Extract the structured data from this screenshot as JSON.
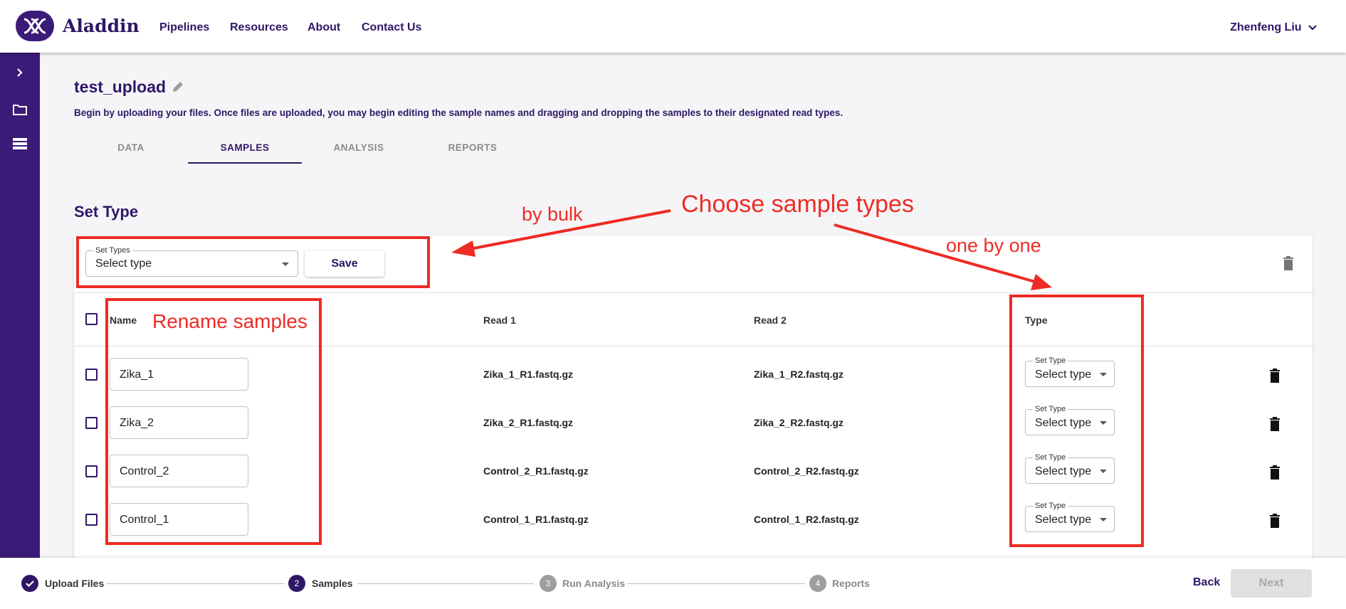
{
  "app": {
    "name": "Aladdin"
  },
  "nav": {
    "items": [
      {
        "label": "Pipelines"
      },
      {
        "label": "Resources"
      },
      {
        "label": "About"
      },
      {
        "label": "Contact Us"
      }
    ]
  },
  "user": {
    "name": "Zhenfeng Liu"
  },
  "sidebar": {
    "items": [
      {
        "icon": "chevron-right-icon"
      },
      {
        "icon": "folder-icon"
      },
      {
        "icon": "list-icon"
      }
    ]
  },
  "project": {
    "title": "test_upload",
    "description": "Begin by uploading your files. Once files are uploaded, you may begin editing the sample names and dragging and dropping the samples to their designated read types."
  },
  "tabs": [
    {
      "label": "DATA"
    },
    {
      "label": "SAMPLES",
      "active": true
    },
    {
      "label": "ANALYSIS"
    },
    {
      "label": "REPORTS"
    }
  ],
  "set_type": {
    "title": "Set Type",
    "bulk_legend": "Set Types",
    "bulk_value": "Select type",
    "save_label": "Save"
  },
  "table": {
    "headers": {
      "name": "Name",
      "read1": "Read 1",
      "read2": "Read 2",
      "type": "Type"
    },
    "rows": [
      {
        "name": "Zika_1",
        "read1": "Zika_1_R1.fastq.gz",
        "read2": "Zika_1_R2.fastq.gz",
        "type_legend": "Set Type",
        "type_value": "Select type"
      },
      {
        "name": "Zika_2",
        "read1": "Zika_2_R1.fastq.gz",
        "read2": "Zika_2_R2.fastq.gz",
        "type_legend": "Set Type",
        "type_value": "Select type"
      },
      {
        "name": "Control_2",
        "read1": "Control_2_R1.fastq.gz",
        "read2": "Control_2_R2.fastq.gz",
        "type_legend": "Set Type",
        "type_value": "Select type"
      },
      {
        "name": "Control_1",
        "read1": "Control_1_R1.fastq.gz",
        "read2": "Control_1_R2.fastq.gz",
        "type_legend": "Set Type",
        "type_value": "Select type"
      }
    ]
  },
  "annotations": {
    "choose_sample_types": "Choose sample types",
    "by_bulk": "by bulk",
    "one_by_one": "one by one",
    "rename_samples": "Rename samples",
    "color": "#ee2b24"
  },
  "stepper": {
    "steps": [
      {
        "label": "Upload Files",
        "state": "done"
      },
      {
        "number": "2",
        "label": "Samples",
        "state": "active"
      },
      {
        "number": "3",
        "label": "Run Analysis",
        "state": "pending"
      },
      {
        "number": "4",
        "label": "Reports",
        "state": "pending"
      }
    ],
    "back_label": "Back",
    "next_label": "Next"
  },
  "colors": {
    "brand": "#3b1a78",
    "brand_text": "#2e1766",
    "annotation": "#ee2b24"
  }
}
